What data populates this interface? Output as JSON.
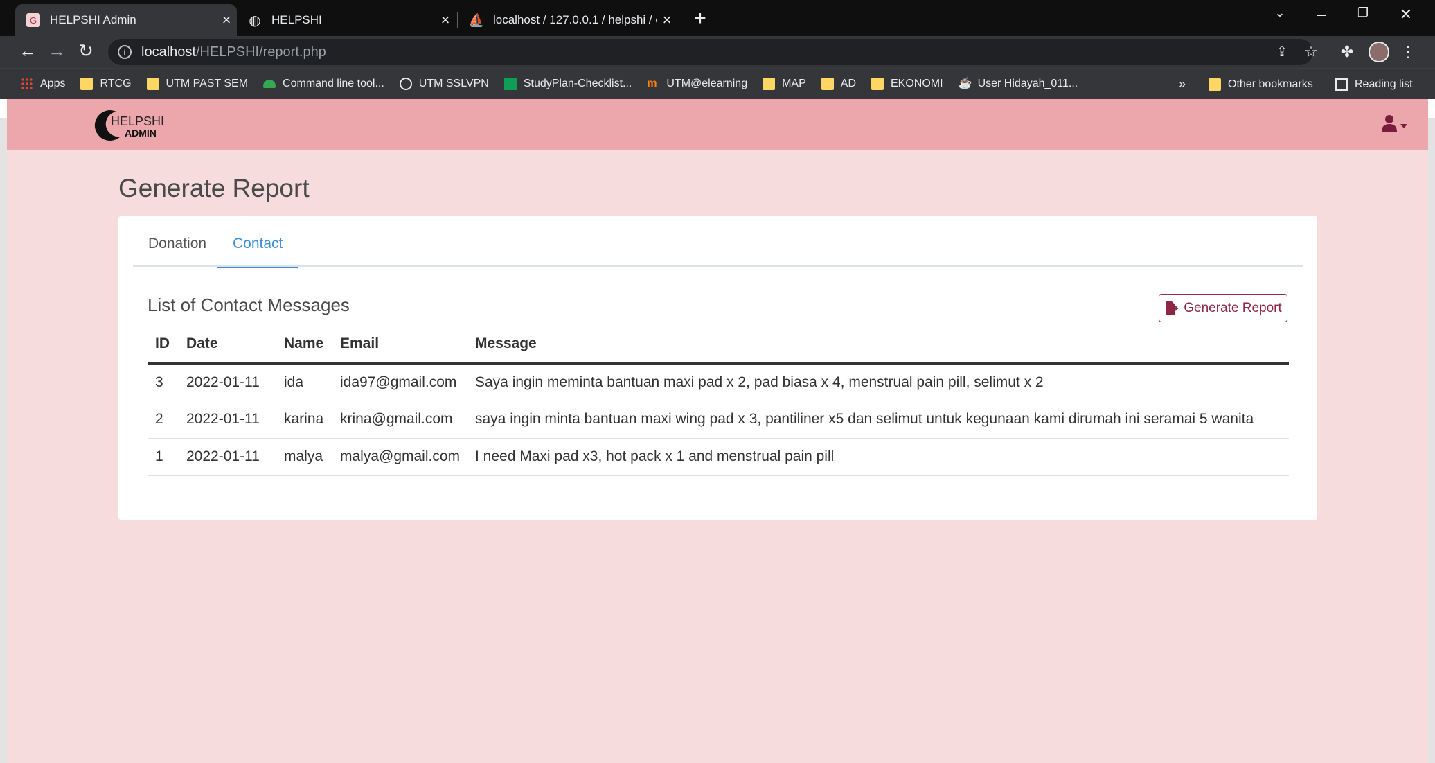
{
  "browser": {
    "tabs": [
      {
        "title": "HELPSHI Admin",
        "active": true
      },
      {
        "title": "HELPSHI",
        "active": false
      },
      {
        "title": "localhost / 127.0.0.1 / helpshi / c",
        "active": false
      }
    ],
    "url_host": "localhost",
    "url_path": "/HELPSHI/report.php",
    "bookmarks": [
      {
        "label": "Apps",
        "icon": "apps-grid-icon"
      },
      {
        "label": "RTCG",
        "icon": "folder-icon"
      },
      {
        "label": "UTM PAST SEM",
        "icon": "folder-icon"
      },
      {
        "label": "Command line tool...",
        "icon": "cloud-icon"
      },
      {
        "label": "UTM SSLVPN",
        "icon": "globe-icon"
      },
      {
        "label": "StudyPlan-Checklist...",
        "icon": "sheet-icon"
      },
      {
        "label": "UTM@elearning",
        "icon": "moodle-icon"
      },
      {
        "label": "MAP",
        "icon": "folder-icon"
      },
      {
        "label": "AD",
        "icon": "folder-icon"
      },
      {
        "label": "EKONOMI",
        "icon": "folder-icon"
      },
      {
        "label": "User Hidayah_011...",
        "icon": "java-icon"
      }
    ],
    "overflow": "»",
    "other_bookmarks": "Other bookmarks",
    "reading_list": "Reading list"
  },
  "app": {
    "logo_text_top": "HELPSHI",
    "logo_text_bottom": "ADMIN",
    "page_title": "Generate Report",
    "tabs": [
      {
        "label": "Donation",
        "active": false
      },
      {
        "label": "Contact",
        "active": true
      }
    ],
    "list_title": "List of Contact Messages",
    "generate_button": "Generate Report",
    "table": {
      "headers": [
        "ID",
        "Date",
        "Name",
        "Email",
        "Message"
      ],
      "rows": [
        [
          "3",
          "2022-01-11",
          "ida",
          "ida97@gmail.com",
          "Saya ingin meminta bantuan maxi pad x 2, pad biasa x 4, menstrual pain pill, selimut x 2"
        ],
        [
          "2",
          "2022-01-11",
          "karina",
          "krina@gmail.com",
          "saya ingin minta bantuan maxi wing pad x 3, pantiliner x5 dan selimut untuk kegunaan kami dirumah ini seramai 5 wanita"
        ],
        [
          "1",
          "2022-01-11",
          "malya",
          "malya@gmail.com",
          "I need Maxi pad x3, hot pack x 1 and menstrual pain pill"
        ]
      ]
    }
  },
  "colors": {
    "navbar": "#eba7ab",
    "page_bg": "#f6dcdd",
    "accent_tab": "#3d8ed6",
    "button": "#8c2846"
  }
}
